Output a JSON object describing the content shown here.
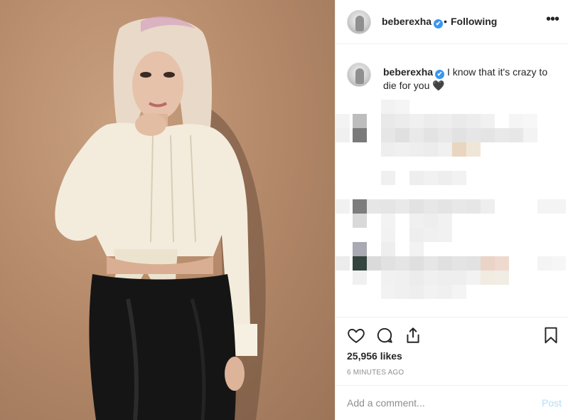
{
  "header": {
    "username": "beberexha",
    "verified_badge": "✔",
    "separator": "•",
    "follow_status": "Following",
    "more_icon": "more-horizontal-icon",
    "more_glyph": "•••"
  },
  "caption": {
    "username": "beberexha",
    "verified_badge": "✔",
    "text": "I know that it's crazy to die for you",
    "emoji": "🖤"
  },
  "actions": {
    "icons": [
      "heart-icon",
      "comment-icon",
      "share-icon",
      "bookmark-icon"
    ],
    "likes": "25,956 likes",
    "timestamp": "6 MINUTES AGO"
  },
  "comment": {
    "placeholder": "Add a comment...",
    "post_label": "Post"
  },
  "colors": {
    "verified_blue": "#3897f0",
    "post_disabled": "#b2dffc",
    "muted_text": "#8e8e8e",
    "photo_background": "#b68b6b"
  }
}
